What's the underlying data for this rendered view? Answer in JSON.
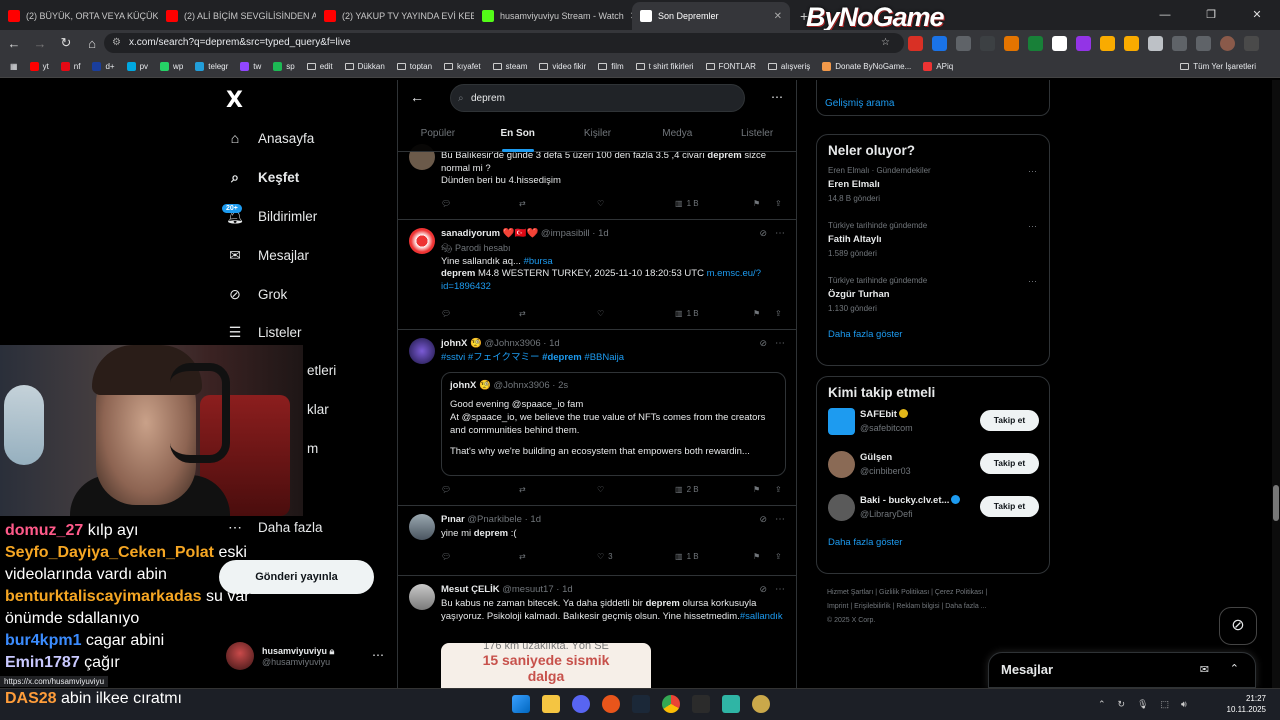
{
  "browser": {
    "tabs": [
      {
        "title": "(2) BÜYÜK, ORTA VEYA KÜÇÜK",
        "fav": "#ff0000"
      },
      {
        "title": "(2) ALİ BİÇİM SEVGİLİSİNDEN A",
        "fav": "#ff0000"
      },
      {
        "title": "(2) YAKUP TV YAYINDA EVİ KEB",
        "fav": "#ff0000"
      },
      {
        "title": "husamviyuviyu Stream - Watch",
        "fav": "#53fc18"
      },
      {
        "title": "Son Depremler",
        "fav": "#ffffff"
      }
    ],
    "new_tab": "+",
    "brand": "ByNoGame",
    "url": "x.com/search?q=deprem&src=typed_query&f=live",
    "bookmarks": [
      "yt",
      "nf",
      "d+",
      "pv",
      "wp",
      "telegr",
      "tw",
      "sp",
      "edit",
      "Dükkan",
      "toptan",
      "kıyafet",
      "steam",
      "video fikir",
      "film",
      "t shirt fikirleri",
      "FONTLAR",
      "alışveriş",
      "Donate ByNoGame...",
      "APiq"
    ],
    "all_bookmarks": "Tüm Yer İşaretleri",
    "status_url": "https://x.com/husamviyuviyu"
  },
  "sidebar": {
    "logo": "X",
    "nav": [
      "Anasayfa",
      "Keşfet",
      "Bildirimler",
      "Mesajlar",
      "Grok",
      "Listeler"
    ],
    "nav_hidden": [
      "etleri",
      "klar",
      "m"
    ],
    "badge": "20+",
    "more": "Daha fazla",
    "post_button": "Gönderi yayınla",
    "account": {
      "name": "husamviyuviyu",
      "handle": "@husamviyuviyu"
    }
  },
  "stream_chat": [
    {
      "user": "domuz_27",
      "color": "#ff5a8a",
      "msg": "kılp ayı"
    },
    {
      "user": "Seyfo_Dayiya_Ceken_Polat",
      "color": "#f5a623",
      "msg": "eski"
    },
    {
      "user": "",
      "color": "#ffffff",
      "msg": "videolarında vardı abin"
    },
    {
      "user": "benturktaliscayimarkadas",
      "color": "#f5a623",
      "msg": "su var"
    },
    {
      "user": "",
      "color": "#ffffff",
      "msg": "önümde sdallanıyo"
    },
    {
      "user": "bur4kpm1",
      "color": "#3b8cff",
      "msg": "cagar abini"
    },
    {
      "user": "Emin1787",
      "color": "#c9c9ff",
      "msg": "çağır"
    }
  ],
  "last_chat": {
    "user": "DAS28",
    "msg": "abin ilkee cıratmı"
  },
  "search": {
    "query": "deprem",
    "tabs": [
      "Popüler",
      "En Son",
      "Kişiler",
      "Medya",
      "Listeler"
    ]
  },
  "tweets": [
    {
      "id": "t0",
      "body1": "Bu Balıkesir'de günde 3 defa 5 üzeri 100 den fazla 3.5 ,4 civarı ",
      "kw": "deprem",
      "body2": " sizce normal mi ?",
      "body3": "Dünden beri bu 4.hissedişim",
      "views": "1 B"
    },
    {
      "id": "t1",
      "name": "sanadiyorum",
      "emoji": "❤️🇹🇷❤️",
      "handle": "@impasibill",
      "time": "1d",
      "parody": "Parodi hesabı",
      "line1": "Yine sallandık aq... ",
      "tag": "#bursa",
      "kw": "deprem",
      "line2": " M4.8 WESTERN TURKEY, 2025-11-10 18:20:53 UTC ",
      "link": "m.emsc.eu/?id=1896432",
      "views": "1 B"
    },
    {
      "id": "t2",
      "name": "johnX",
      "handle": "@Johnx3906",
      "time": "1d",
      "tags_a": "#sstvi #フェイクマミー ",
      "tag_kw": "#deprem",
      "tags_b": " #BBNaija",
      "quote_name": "johnX",
      "quote_handle": "@Johnx3906",
      "quote_time": "2s",
      "quote_l1": "Good evening @spaace_io fam",
      "quote_l2": "At @spaace_io, we believe the true value of NFTs comes from the creators and communities behind them.",
      "quote_l3": "That's why we're building an ecosystem that empowers both rewardin...",
      "views": "2 B"
    },
    {
      "id": "t3",
      "name": "Pınar",
      "handle": "@Pnarkibele",
      "time": "1d",
      "pre": "yine mi ",
      "kw": "deprem",
      "post": " :(",
      "likes": "3",
      "views": "1 B"
    },
    {
      "id": "t4",
      "name": "Mesut ÇELİK",
      "handle": "@mesuut17",
      "time": "1d",
      "pre": "Bu kabus ne zaman bitecek. Ya daha şiddetli bir ",
      "kw": "deprem",
      "post": " olursa korkusuyla yaşıyoruz. Psikoloji kalmadı. Balıkesir geçmiş olsun. Yine hissetmedim.",
      "tag": "#sallandık",
      "card_l1": "176 km uzaklıkta. Yön SE",
      "card_l2": "15 saniyede sismik",
      "card_l3": "dalga"
    }
  ],
  "right": {
    "advanced": "Gelişmiş arama",
    "trends_title": "Neler oluyor?",
    "trends": [
      {
        "ctx": "Eren Elmalı · Gündemdekiler",
        "title": "Eren Elmalı",
        "count": "14,8 B gönderi"
      },
      {
        "ctx": "Türkiye tarihinde gündemde",
        "title": "Fatih Altaylı",
        "count": "1.589 gönderi"
      },
      {
        "ctx": "Türkiye tarihinde gündemde",
        "title": "Özgür Turhan",
        "count": "1.130 gönderi"
      }
    ],
    "show_more": "Daha fazla göster",
    "who_title": "Kimi takip etmeli",
    "who": [
      {
        "name": "SAFEbit",
        "handle": "@safebitcom",
        "badge": "#e2b719",
        "avatar": "#1d9bf0"
      },
      {
        "name": "Gülşen",
        "handle": "@cinbiber03",
        "badge": "",
        "avatar": "#8a6a55"
      },
      {
        "name": "Baki - bucky.clv.et...",
        "handle": "@LibraryDefi",
        "badge": "#1d9bf0",
        "avatar": "#5a5a5a"
      }
    ],
    "follow": "Takip et",
    "footer_l1": "Hizmet Şartları  |  Gizlilik Politikası  |  Çerez Politikası  |",
    "footer_l2": "Imprint  |  Erişilebilirlik  |  Reklam bilgisi  |  Daha fazla ...",
    "footer_l3": "© 2025 X Corp."
  },
  "messages_dock": "Mesajlar",
  "clock": {
    "time": "21:27",
    "date": "10.11.2025"
  }
}
